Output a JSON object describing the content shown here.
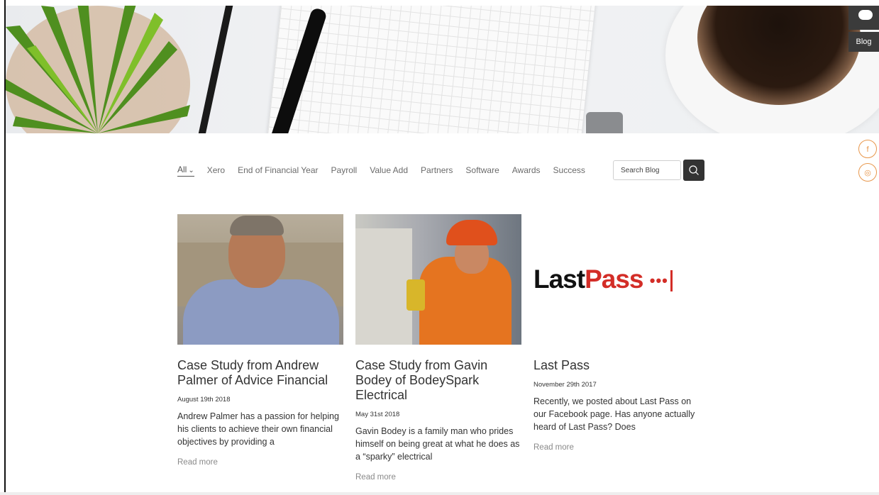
{
  "side_tabs": {
    "blog_label": "Blog"
  },
  "social": {
    "facebook_glyph": "f",
    "instagram_glyph": "◎",
    "accent": "#e8974c"
  },
  "filters": {
    "items": [
      "All",
      "Xero",
      "End of Financial Year",
      "Payroll",
      "Value Add",
      "Partners",
      "Software",
      "Awards",
      "Success"
    ],
    "active_caret": "⌄"
  },
  "search": {
    "placeholder": "Search Blog",
    "button_icon": "search-icon"
  },
  "posts": [
    {
      "title": "Case Study from Andrew Palmer of Advice Financial",
      "date": "August 19th 2018",
      "excerpt": "Andrew Palmer has a passion for helping his clients to achieve their own financial objectives by providing a",
      "read_more": "Read more"
    },
    {
      "title": "Case Study from Gavin Bodey of BodeySpark Electrical",
      "date": "May 31st 2018",
      "excerpt": "Gavin Bodey is a family man who prides himself on being great at what he does as a “sparky” electrical",
      "read_more": "Read more"
    },
    {
      "title": "Last Pass",
      "date": "November 29th 2017",
      "excerpt": "Recently, we posted about Last Pass on our Facebook page. Has anyone actually heard of Last Pass? Does",
      "read_more": "Read more",
      "logo": {
        "part1": "Last",
        "part2": "Pass",
        "dots": "•••",
        "color": "#d32d27"
      }
    }
  ]
}
